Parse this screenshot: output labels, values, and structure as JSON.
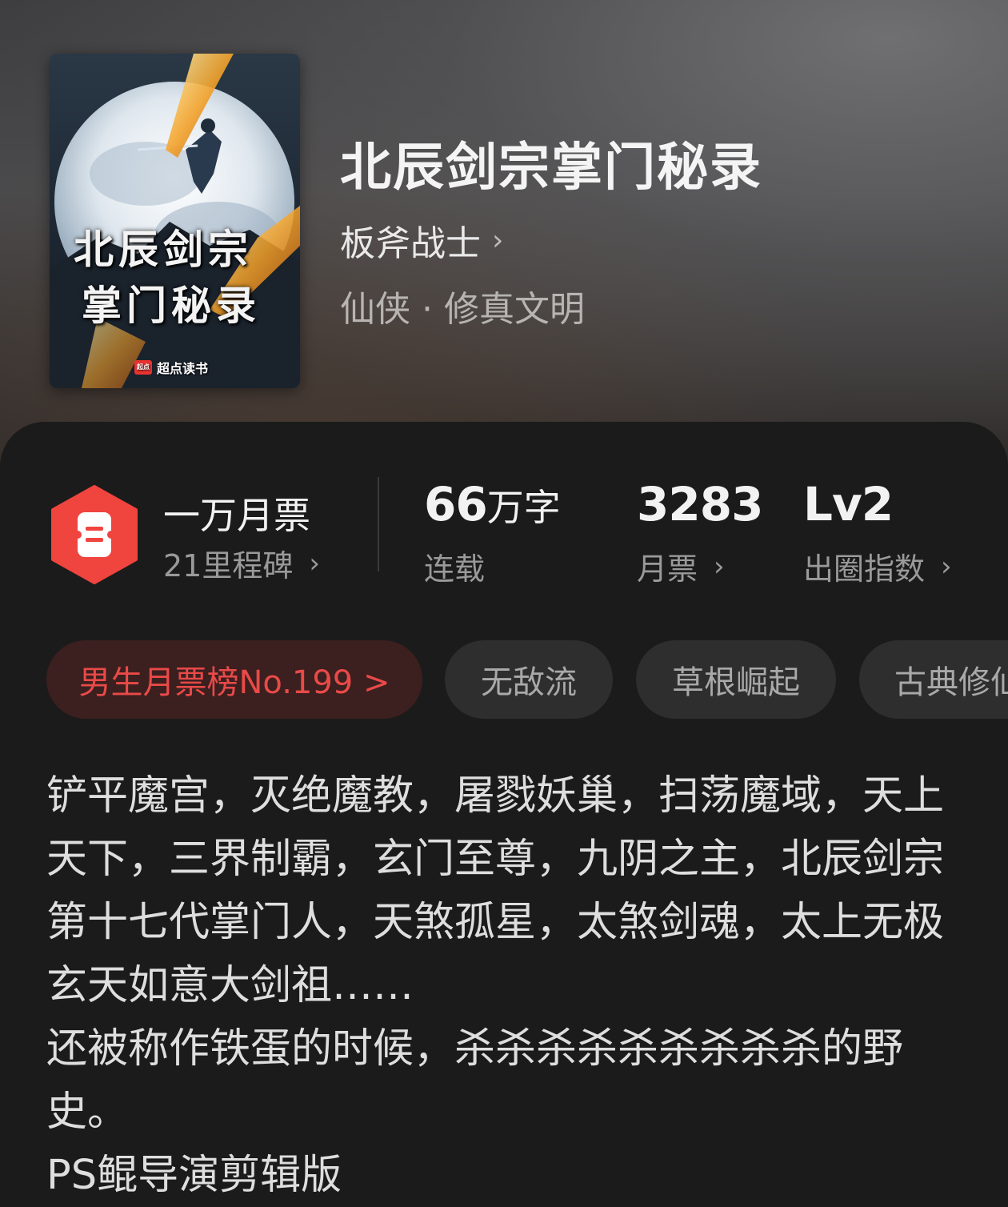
{
  "book": {
    "title": "北辰剑宗掌门秘录",
    "author": "板斧战士",
    "author_chevron": "›",
    "genre": "仙侠 · 修真文明",
    "cover": {
      "title_line1": "北辰剑宗",
      "title_line2": "掌门秘录",
      "brand": "超点读书",
      "brand_logo_text": "起点"
    }
  },
  "stats": {
    "monthly_ticket": {
      "title": "一万月票",
      "subtitle": "21里程碑",
      "chevron": "›",
      "icon": "ticket-icon",
      "icon_color": "#f0443f"
    },
    "word_count": {
      "number": "66",
      "unit": "万字",
      "label": "连载"
    },
    "tickets": {
      "number": "3283",
      "label": "月票",
      "chevron": "›"
    },
    "level": {
      "value": "Lv2",
      "label": "出圈指数",
      "chevron": "›"
    }
  },
  "tags": {
    "rank": "男生月票榜No.199 >",
    "items": [
      "无敌流",
      "草根崛起",
      "古典修仙"
    ]
  },
  "description": {
    "paragraph1": "铲平魔宫，灭绝魔教，屠戮妖巢，扫荡魔域，天上天下，三界制霸，玄门至尊，九阴之主，北辰剑宗第十七代掌门人，天煞孤星，太煞剑魂，太上无极玄天如意大剑祖……",
    "paragraph2": "还被称作铁蛋的时候，杀杀杀杀杀杀杀杀杀的野史。",
    "paragraph3": "PS鲲导演剪辑版"
  },
  "colors": {
    "accent_red": "#e84a48",
    "background": "#1b1b1b"
  }
}
